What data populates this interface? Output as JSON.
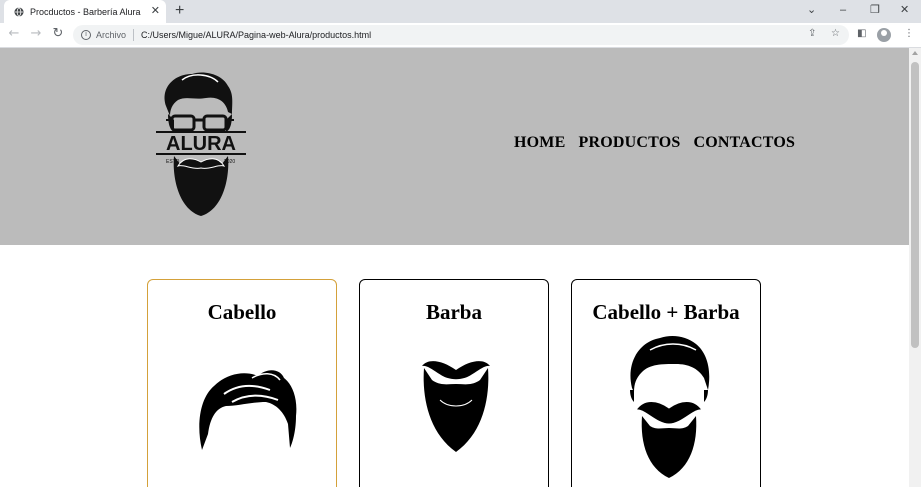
{
  "browser": {
    "tab_title": "Procductos - Barbería Alura",
    "new_tab": "+",
    "address_scheme": "Archivo",
    "address_url": "C:/Users/Migue/ALURA/Pagina-web-Alura/productos.html"
  },
  "header": {
    "logo": {
      "brand": "ALURA",
      "left_text": "ESTD",
      "right_text": "2020"
    },
    "nav": [
      "HOME",
      "PRODUCTOS",
      "CONTACTOS"
    ]
  },
  "cards": [
    {
      "title": "Cabello",
      "icon": "hair-icon",
      "border_color": "#d4a13a"
    },
    {
      "title": "Barba",
      "icon": "beard-icon",
      "border_color": "#000000"
    },
    {
      "title": "Cabello + Barba",
      "icon": "hair-beard-icon",
      "border_color": "#000000"
    }
  ],
  "colors": {
    "header_bg": "#bbbbbb",
    "selected_card_border": "#d4a13a"
  }
}
